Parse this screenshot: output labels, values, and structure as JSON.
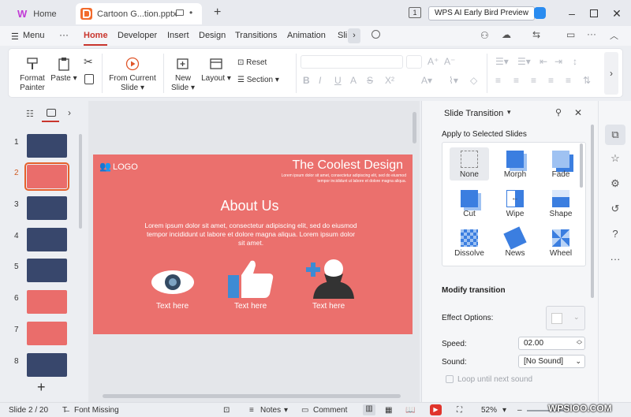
{
  "titlebar": {
    "home_tab": "Home",
    "file_tab": "Cartoon G...tion.pptx",
    "badge_count": "1",
    "wps_ai": "WPS AI Early Bird Preview"
  },
  "menubar": {
    "menu": "Menu",
    "tabs": [
      "Home",
      "Developer",
      "Insert",
      "Design",
      "Transitions",
      "Animation",
      "Sli"
    ]
  },
  "ribbon": {
    "format_painter": "Format Painter",
    "paste": "Paste",
    "from_current_slide": "From Current Slide",
    "new_slide": "New Slide",
    "layout": "Layout",
    "reset": "Reset",
    "section": "Section"
  },
  "thumbnails": [
    "1",
    "2",
    "3",
    "4",
    "5",
    "6",
    "7",
    "8"
  ],
  "slide": {
    "logo": "LOGO",
    "title": "The Coolest Design",
    "subtitle1": "Lorem ipsum dolor sit amet, consectetur adipiscing elit, sed do eiusmod",
    "subtitle2": "tempor incididunt ut labore et dolore magna aliqua.",
    "heading": "About Us",
    "body": "Lorem ipsum dolor sit amet, consectetur adipiscing elit, sed do eiusmod tempor incididunt ut labore et dolore magna aliqua. Lorem ipsum dolor sit amet.",
    "label1": "Text here",
    "label2": "Text here",
    "label3": "Text here"
  },
  "pane": {
    "title": "Slide Transition",
    "apply": "Apply to Selected Slides",
    "transitions": [
      "None",
      "Morph",
      "Fade",
      "Cut",
      "Wipe",
      "Shape",
      "Dissolve",
      "News",
      "Wheel"
    ],
    "modify": "Modify transition",
    "effect_options": "Effect Options:",
    "speed_label": "Speed:",
    "speed_value": "02.00",
    "sound_label": "Sound:",
    "sound_value": "[No Sound]",
    "loop": "Loop until next sound"
  },
  "status": {
    "slide": "Slide 2 / 20",
    "font_missing": "Font Missing",
    "notes": "Notes",
    "comment": "Comment",
    "zoom": "52%"
  },
  "watermark": "WPSIOO.COM",
  "colors": {
    "accent": "#c9352d",
    "slide_bg": "#eb706d",
    "ppt_orange": "#f26b2c",
    "selection": "#e5602b"
  }
}
